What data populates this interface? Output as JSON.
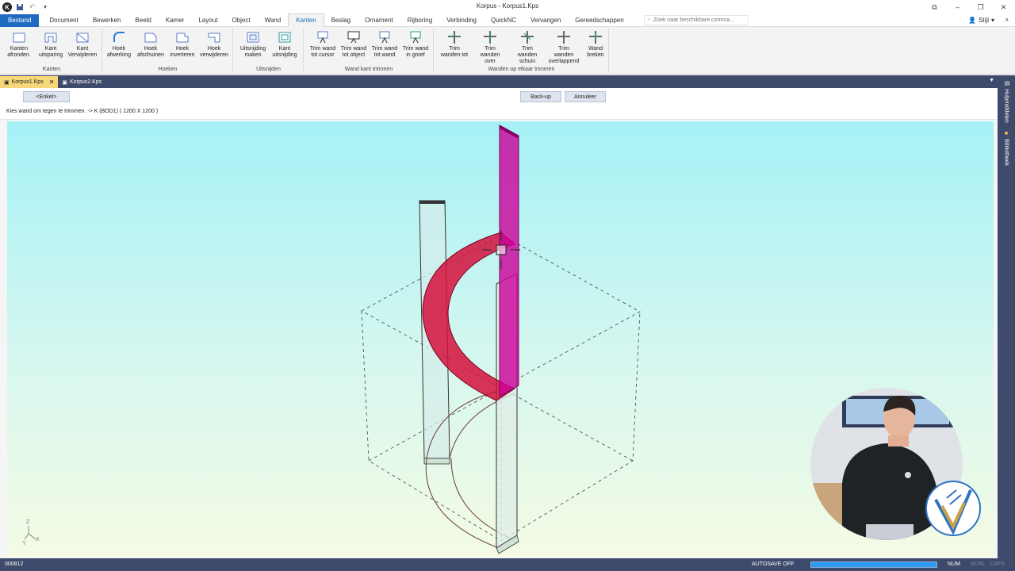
{
  "window": {
    "title": "Korpus - Korpus1.Kps",
    "style_menu": "Stijl"
  },
  "ribbon_tabs": [
    "Bestand",
    "Document",
    "Bewerken",
    "Beeld",
    "Kamer",
    "Layout",
    "Object",
    "Wand",
    "Kanten",
    "Beslag",
    "Ornament",
    "Rijboring",
    "Verbinding",
    "QuickNC",
    "Vervangen",
    "Gereedschappen"
  ],
  "active_tab": "Kanten",
  "search": {
    "placeholder": "Zoek naar beschikbare comma..."
  },
  "ribbon": {
    "kanten": {
      "label": "Kanten",
      "buttons": [
        {
          "l1": "Kanten",
          "l2": "afronden."
        },
        {
          "l1": "Kant",
          "l2": "uitsparing"
        },
        {
          "l1": "Kant",
          "l2": "Verwijderen"
        }
      ]
    },
    "hoeken": {
      "label": "Hoeken",
      "buttons": [
        {
          "l1": "Hoek",
          "l2": "afwerking"
        },
        {
          "l1": "Hoek",
          "l2": "afschuinen"
        },
        {
          "l1": "Hoek",
          "l2": "inverteren"
        },
        {
          "l1": "Hoek",
          "l2": "verwijderen"
        }
      ]
    },
    "uitsnijden": {
      "label": "Uitsnijden",
      "buttons": [
        {
          "l1": "Uitsnijding",
          "l2": "maken"
        },
        {
          "l1": "Kant",
          "l2": "uitsnijding"
        }
      ]
    },
    "wandkant": {
      "label": "Wand kant trimmen",
      "buttons": [
        {
          "l1": "Trim wand",
          "l2": "tot cursor"
        },
        {
          "l1": "Trim wand",
          "l2": "tot object"
        },
        {
          "l1": "Trim wand",
          "l2": "tot wand"
        },
        {
          "l1": "Trim wand",
          "l2": "in groef"
        }
      ]
    },
    "wandenelkaar": {
      "label": "Wanden op elkaar trimmen",
      "buttons": [
        {
          "l1": "Trim",
          "l2": "wanden tot"
        },
        {
          "l1": "Trim",
          "l2": "wanden over"
        },
        {
          "l1": "Trim wanden",
          "l2": "schuin"
        },
        {
          "l1": "Trim wanden",
          "l2": "overlappend"
        },
        {
          "l1": "Wand",
          "l2": "breken"
        }
      ]
    }
  },
  "doc_tabs": [
    {
      "label": "Korpus1.Kps",
      "active": true
    },
    {
      "label": "Korpus2.Kps",
      "active": false
    }
  ],
  "side_tabs": [
    "Hulpmiddelen",
    "Bibliotheek"
  ],
  "command": {
    "enkel": "<Enkel>",
    "backup": "Back-up",
    "cancel": "Annuleer",
    "prompt": "Kies wand om tegen te trimmen. -> K (BOD1)  ( 1200 X 1200 )"
  },
  "axes": {
    "z": "Z",
    "y": "Y",
    "x": "X"
  },
  "status": {
    "code": "000812",
    "autosave": "AUTOSAVE OFF",
    "progress": 1.0,
    "num": "NUM",
    "scrl": "SCRL",
    "caps": "CAPS"
  },
  "colors": {
    "accent": "#1f6bc1",
    "dark_bar": "#3e4a6b",
    "active_doc_tab": "#f6d87a",
    "selected_wall": "#cc0099",
    "highlighted_shape": "#d4103c"
  }
}
